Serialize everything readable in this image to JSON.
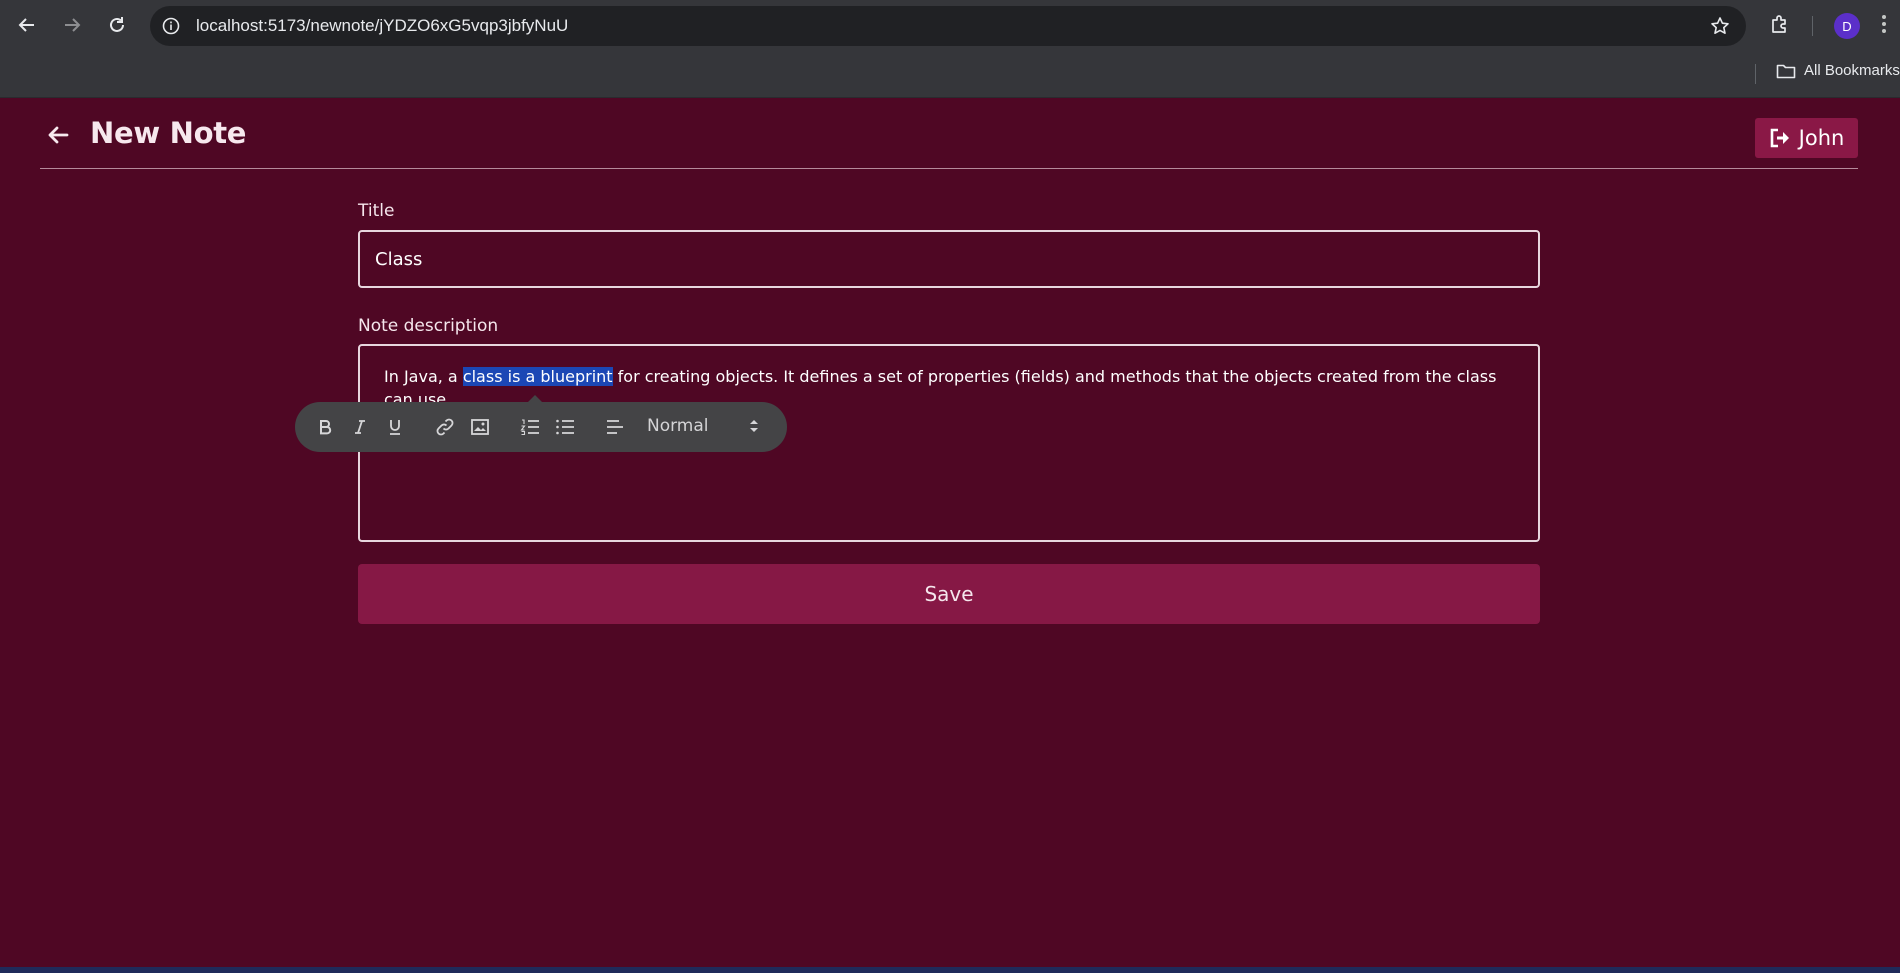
{
  "browser": {
    "url": "localhost:5173/newnote/jYDZO6xG5vqp3jbfyNuU",
    "profile_initial": "D",
    "bookmarks_label": "All Bookmarks"
  },
  "header": {
    "title": "New Note",
    "user_name": "John"
  },
  "form": {
    "title_label": "Title",
    "title_value": "Class",
    "description_label": "Note description",
    "description_before": "In Java, a ",
    "description_selected": "class is a blueprint",
    "description_after": " for creating objects. It defines a set of properties (fields) and methods that the objects created from the class can use.",
    "save_label": "Save"
  },
  "toolbar": {
    "buttons": [
      "bold-icon",
      "italic-icon",
      "underline-icon",
      "link-icon",
      "image-icon",
      "ordered-list-icon",
      "bullet-list-icon",
      "align-icon"
    ],
    "header_select": "Normal"
  },
  "colors": {
    "page_bg": "#4f0724",
    "accent": "#861845",
    "selection": "#1b47b5"
  }
}
